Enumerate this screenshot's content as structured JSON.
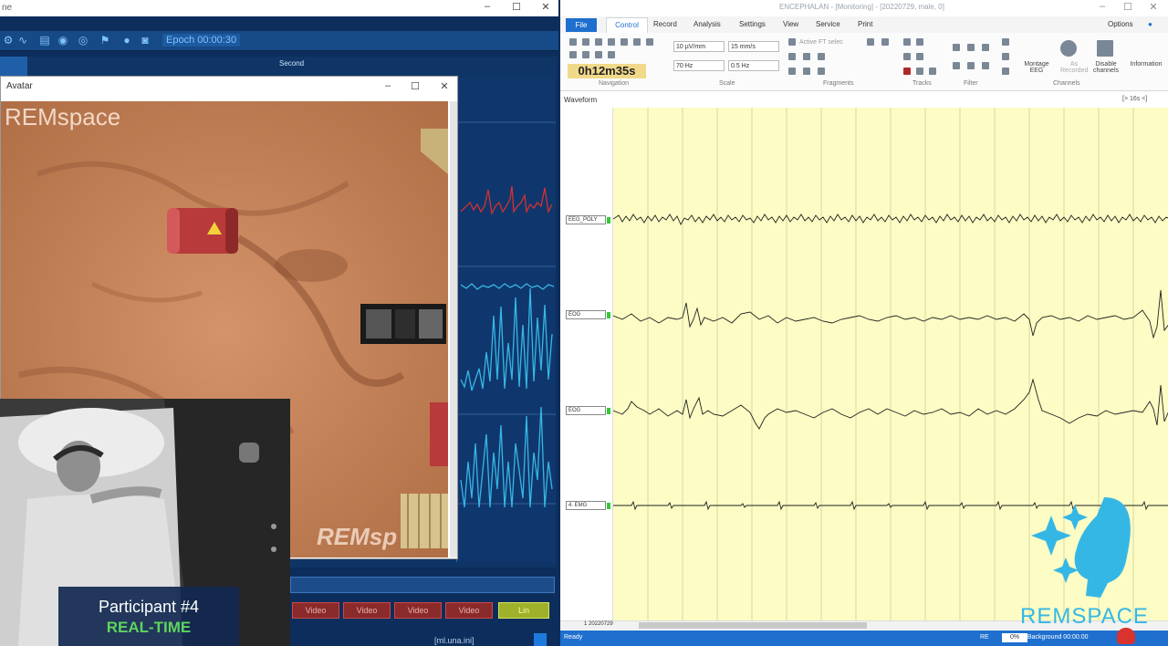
{
  "left_app": {
    "title": "ne",
    "epoch_label": "Epoch 00:00:30",
    "second_label": "Second",
    "bottom_buttons": [
      "Video",
      "Video",
      "Video",
      "Video"
    ],
    "yellow_button": "Lin",
    "file_label": "[ml.una.ini]"
  },
  "avatar_window": {
    "title": "Avatar",
    "logo_text": "REMspace",
    "logo_bottom": "REMsp"
  },
  "participant": {
    "label": "Participant #4",
    "status": "REAL-TIME"
  },
  "right_app": {
    "title": "ENCEPHALAN - [Monitoring] - [20220729, male, 0]",
    "tabs": [
      "File",
      "Control",
      "Record",
      "Analysis",
      "Settings",
      "View",
      "Service",
      "Print"
    ],
    "options_label": "Options",
    "time_display": "0h12m35s",
    "scale_fields": [
      "10 µV/mm",
      "15 mm/s",
      "70 Hz",
      "0.5 Hz"
    ],
    "active_filter": "Active FT selec",
    "group_labels": [
      "Navigation",
      "Scale",
      "Fragments",
      "Tracks",
      "Filter",
      "Channels"
    ],
    "montage_label": "Montage EEG",
    "as_recorded_label": "As Recorded",
    "disable_channels_label": "Disable channels",
    "information_label": "Information",
    "waveform_label": "Waveform",
    "waveform_range": "[> 16s <]",
    "channels": [
      "EEG_POLY",
      "EOG",
      "EOG",
      "4. EMG"
    ],
    "scroll_label": "1 20220729",
    "status_ready": "Ready",
    "status_re": "RE",
    "status_pct": "0%",
    "status_background": "Background 00:00:00"
  },
  "brand": {
    "text": "REMSPACE",
    "color": "#35b7e6"
  },
  "colors": {
    "plot_bg": "#fcfcc4",
    "left_bg": "#0d2d5c",
    "accent_blue": "#1e6fce"
  }
}
